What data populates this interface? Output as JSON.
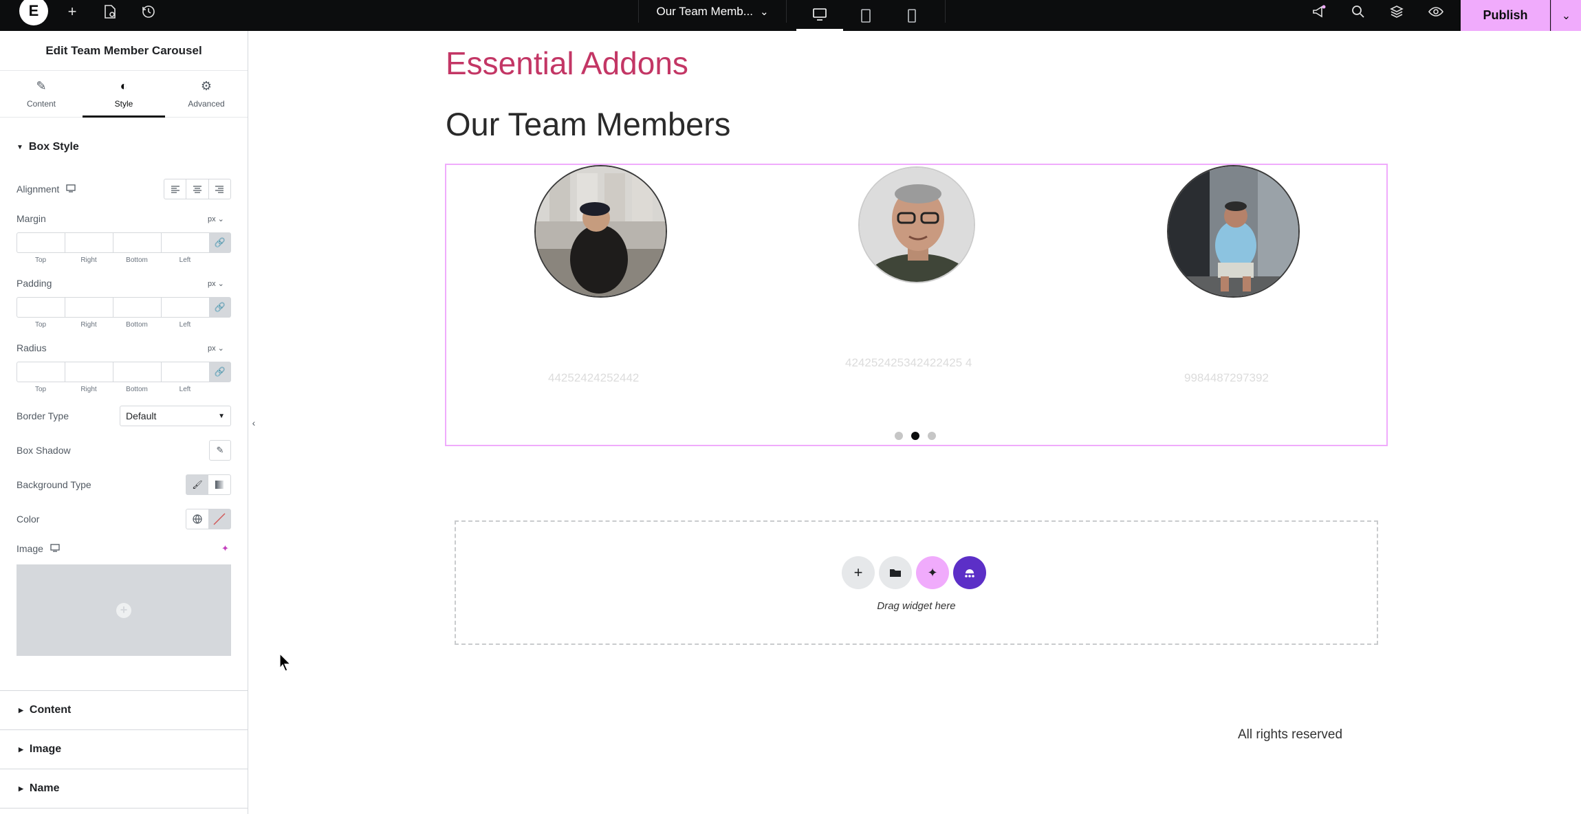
{
  "topbar": {
    "logo": "E",
    "page_title": "Our Team Memb...",
    "publish_label": "Publish"
  },
  "panel": {
    "title": "Edit Team Member Carousel",
    "tabs": [
      {
        "label": "Content",
        "icon": "pencil-icon"
      },
      {
        "label": "Style",
        "icon": "half-circle-icon"
      },
      {
        "label": "Advanced",
        "icon": "gear-icon"
      }
    ],
    "section_title": "Box Style",
    "alignment_label": "Alignment",
    "margin": {
      "label": "Margin",
      "unit": "px"
    },
    "padding": {
      "label": "Padding",
      "unit": "px"
    },
    "radius": {
      "label": "Radius",
      "unit": "px"
    },
    "dim_labels": [
      "Top",
      "Right",
      "Bottom",
      "Left"
    ],
    "border_type": {
      "label": "Border Type",
      "value": "Default"
    },
    "box_shadow_label": "Box Shadow",
    "background_type_label": "Background Type",
    "color_label": "Color",
    "image_label": "Image",
    "accordions": [
      "Content",
      "Image",
      "Name"
    ]
  },
  "canvas": {
    "brand": "Essential Addons",
    "heading": "Our Team Members",
    "members": [
      {
        "phone": "44252424252442"
      },
      {
        "phone": "424252425342422425 4"
      },
      {
        "phone": "9984487297392"
      }
    ],
    "dropzone_text": "Drag widget here",
    "footer": "All rights reserved"
  },
  "colors": {
    "accent": "#f0abfc",
    "brand": "#c33665",
    "topbar": "#0c0d0e",
    "ai_purple": "#5c2fc7"
  }
}
